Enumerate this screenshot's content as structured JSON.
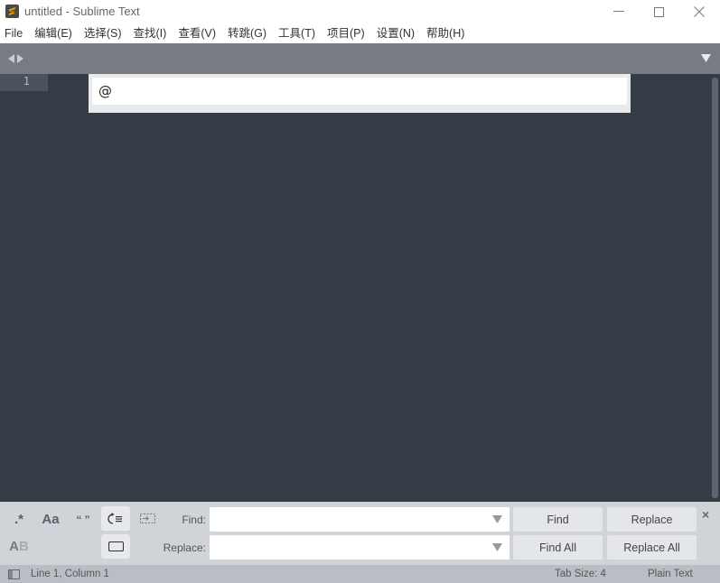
{
  "window": {
    "title": "untitled - Sublime Text",
    "app_icon": "sublime-logo-icon",
    "controls": [
      "minimize-icon",
      "maximize-icon",
      "close-icon"
    ]
  },
  "menu": {
    "items": [
      {
        "label": "File"
      },
      {
        "label": "编辑(E)"
      },
      {
        "label": "选择(S)"
      },
      {
        "label": "查找(I)"
      },
      {
        "label": "查看(V)"
      },
      {
        "label": "转跳(G)"
      },
      {
        "label": "工具(T)"
      },
      {
        "label": "项目(P)"
      },
      {
        "label": "设置(N)"
      },
      {
        "label": "帮助(H)"
      }
    ]
  },
  "tabbar": {
    "nav_icons": [
      "tab-left-arrow-icon",
      "tab-right-arrow-icon"
    ],
    "dropdown_icon": "tab-list-dropdown-icon"
  },
  "editor": {
    "line_numbers": [
      "1"
    ],
    "current_line": 1
  },
  "goto_overlay": {
    "input_value": "@"
  },
  "find_panel": {
    "options": [
      {
        "name": "regex",
        "glyph": ".*",
        "active": false
      },
      {
        "name": "case-sensitive",
        "glyph": "Aa",
        "active": false
      },
      {
        "name": "whole-word",
        "glyph": "“ ”",
        "active": false
      },
      {
        "name": "wrap",
        "glyph": "wrap",
        "active": true
      },
      {
        "name": "in-selection",
        "glyph": "in-selection",
        "active": false
      },
      {
        "name": "preserve-case",
        "glyph": "AB",
        "active": false
      },
      {
        "name": "highlight-matches",
        "glyph": "highlight",
        "active": true
      }
    ],
    "find_label": "Find:",
    "replace_label": "Replace:",
    "find_value": "",
    "replace_value": "",
    "buttons": {
      "find": "Find",
      "replace": "Replace",
      "find_all": "Find All",
      "replace_all": "Replace All"
    },
    "close_glyph": "×"
  },
  "statusbar": {
    "position": "Line 1, Column 1",
    "tab_size": "Tab Size: 4",
    "syntax": "Plain Text"
  },
  "colors": {
    "editor_bg": "#353c46",
    "tabbar_bg": "#777b83",
    "findpanel_bg": "#d0d3d8",
    "statusbar_bg": "#b9bec5",
    "brand_orange": "#f39c12"
  }
}
